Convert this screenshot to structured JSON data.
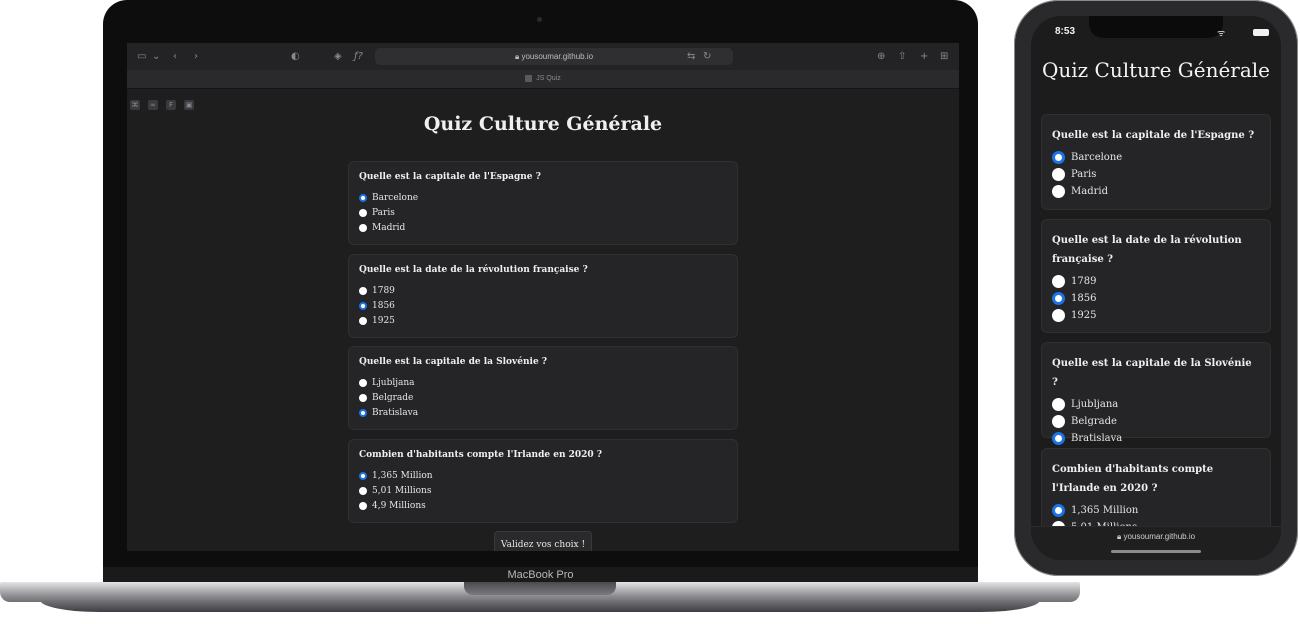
{
  "mac": {
    "device_label": "MacBook Pro",
    "browser": {
      "url": "yousoumar.github.io",
      "tab_title": "JS Quiz"
    }
  },
  "iphone": {
    "time": "8:53",
    "url": "yousoumar.github.io"
  },
  "quiz": {
    "title": "Quiz Culture Générale",
    "submit_label": "Validez vos choix !",
    "questions": [
      {
        "question": "Quelle est la capitale de l'Espagne ?",
        "options": [
          "Barcelone",
          "Paris",
          "Madrid"
        ],
        "selected": "Barcelone"
      },
      {
        "question": "Quelle est la date de la révolution française ?",
        "options": [
          "1789",
          "1856",
          "1925"
        ],
        "selected": "1856"
      },
      {
        "question": "Quelle est la capitale de la Slovénie ?",
        "options": [
          "Ljubljana",
          "Belgrade",
          "Bratislava"
        ],
        "selected": "Bratislava"
      },
      {
        "question": "Combien d'habitants compte l'Irlande en 2020 ?",
        "options": [
          "1,365 Million",
          "5,01 Millions",
          "4,9 Millions"
        ],
        "selected": "1,365 Million"
      }
    ]
  },
  "colors": {
    "page_bg": "#1e1e1f",
    "card_bg": "#252527",
    "radio_accent": "#1a73e8"
  }
}
